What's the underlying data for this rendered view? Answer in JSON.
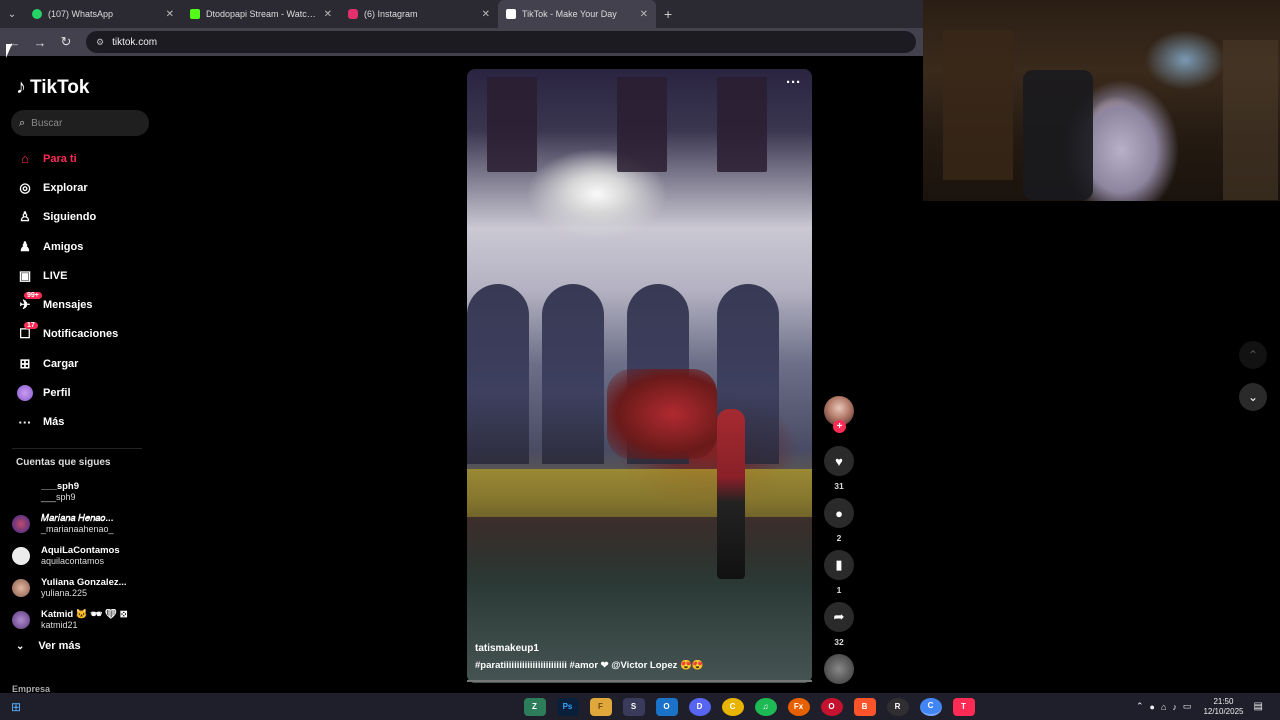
{
  "browser": {
    "tabs": [
      {
        "label": "(107) WhatsApp",
        "color": "#25d366",
        "active": false
      },
      {
        "label": "Dtodopapi Stream - Watch Live",
        "color": "#53fc18",
        "active": false
      },
      {
        "label": "(6) Instagram",
        "color": "#e1306c",
        "active": false
      },
      {
        "label": "TikTok - Make Your Day",
        "color": "#ffffff",
        "active": true
      }
    ],
    "new_tab": "+",
    "address": "tiktok.com"
  },
  "sidebar": {
    "logo": "TikTok",
    "search_placeholder": "Buscar",
    "nav": [
      {
        "label": "Para ti",
        "icon": "home-icon",
        "glyph": "⌂",
        "active": true
      },
      {
        "label": "Explorar",
        "icon": "compass-icon",
        "glyph": "◎"
      },
      {
        "label": "Siguiendo",
        "icon": "following-icon",
        "glyph": "♙"
      },
      {
        "label": "Amigos",
        "icon": "friends-icon",
        "glyph": "♟"
      },
      {
        "label": "LIVE",
        "icon": "live-icon",
        "glyph": "▣"
      },
      {
        "label": "Mensajes",
        "icon": "messages-icon",
        "glyph": "✈",
        "badge": "99+"
      },
      {
        "label": "Notificaciones",
        "icon": "notifications-icon",
        "glyph": "☐",
        "badge": "17"
      },
      {
        "label": "Cargar",
        "icon": "upload-icon",
        "glyph": "⊞"
      },
      {
        "label": "Perfil",
        "icon": "profile-icon",
        "glyph": "●"
      },
      {
        "label": "Más",
        "icon": "more-icon",
        "glyph": "···"
      }
    ],
    "following_title": "Cuentas que sigues",
    "following": [
      {
        "name": "___sph9",
        "user": "___sph9",
        "color": "#000000"
      },
      {
        "name": "𝑀𝑎𝑟𝑖𝑎𝑛𝑎 𝐻𝑒𝑛𝑎𝑜...",
        "user": "_marianaahenao_",
        "color": "#6a4a9a"
      },
      {
        "name": "AquiLaContamos",
        "user": "aquilacontamos",
        "color": "#ececec"
      },
      {
        "name": "Yuliana Gonzalez...",
        "user": "yuliana.225",
        "color": "#c0907a"
      },
      {
        "name": "Katmid 🐱 🕶 ❤ ⊠",
        "user": "katmid21",
        "color": "#8a6aa8"
      }
    ],
    "see_more": "Ver más",
    "footer": "Empresa"
  },
  "video": {
    "author": "tatismakeup1",
    "caption": "#paratiiiiiiiiiiiiiiiiiiiiiiii #amor ❤ @Victor Lopez 😍😍",
    "more": "···"
  },
  "actions": {
    "follow": "+",
    "likes": "31",
    "comments": "2",
    "saves": "1",
    "shares": "32"
  },
  "taskbar": {
    "icons": [
      "Z",
      "Ps",
      "F",
      "S",
      "O",
      "D",
      "C",
      "♫",
      "Fx",
      "O",
      "B",
      "R",
      "C",
      "T"
    ],
    "time": "21:50",
    "date": "12/10/2025"
  }
}
